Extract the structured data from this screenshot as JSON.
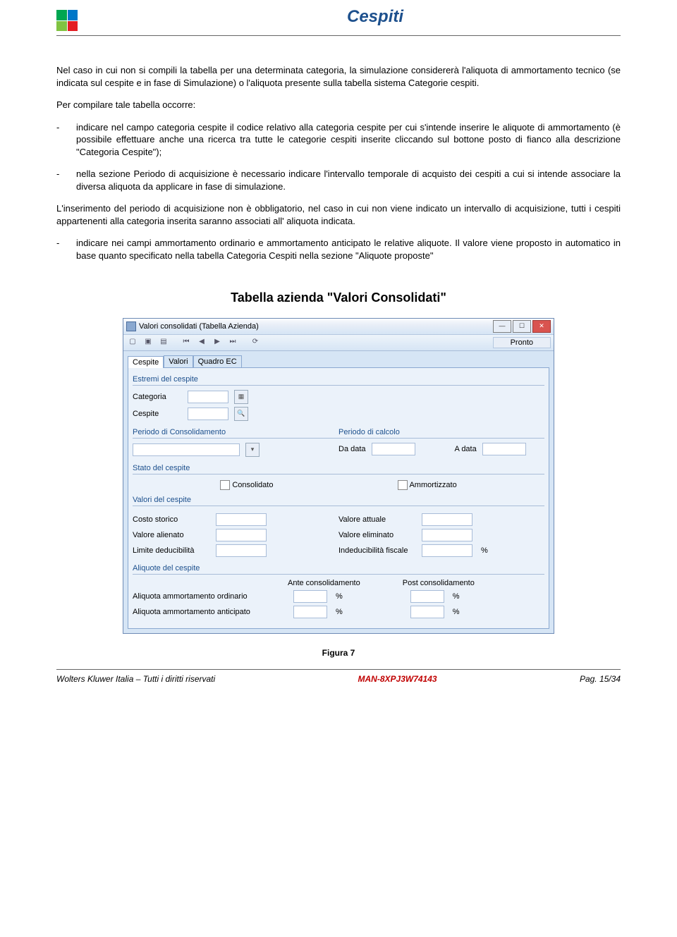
{
  "header": {
    "title": "Cespiti"
  },
  "text": {
    "p1": "Nel caso in cui non si compili la tabella per una determinata categoria, la simulazione considererà l'aliquota di ammortamento tecnico (se indicata sul cespite e in fase di Simulazione) o l'aliquota presente sulla tabella sistema Categorie cespiti.",
    "p2": "Per compilare tale tabella occorre:",
    "b1": "indicare nel campo categoria cespite il codice relativo alla categoria cespite per cui s'intende inserire le aliquote di ammortamento (è possibile effettuare anche una ricerca tra tutte le categorie cespiti inserite cliccando sul bottone posto di fianco alla descrizione \"Categoria Cespite\");",
    "b2": "nella sezione Periodo di acquisizione è necessario indicare l'intervallo temporale di acquisto dei cespiti a cui si intende associare la diversa aliquota da applicare in fase di simulazione.",
    "p3": "L'inserimento del periodo di acquisizione non è obbligatorio, nel caso in cui non viene indicato un intervallo di acquisizione, tutti i cespiti appartenenti alla categoria inserita saranno associati all' aliquota indicata.",
    "b3": "indicare nei campi ammortamento ordinario e ammortamento anticipato le relative aliquote. Il valore viene proposto in automatico in base quanto specificato nella tabella Categoria Cespiti nella sezione \"Aliquote proposte\""
  },
  "heading": "Tabella azienda \"Valori Consolidati\"",
  "win": {
    "title": "Valori consolidati (Tabella Azienda)",
    "status": "Pronto",
    "tabs": [
      "Cespite",
      "Valori",
      "Quadro EC"
    ],
    "groups": {
      "estremi": "Estremi del cespite",
      "periodoCons": "Periodo di Consolidamento",
      "periodoCalc": "Periodo di calcolo",
      "stato": "Stato del cespite",
      "valori": "Valori del cespite",
      "aliquote": "Aliquote del cespite"
    },
    "labels": {
      "categoria": "Categoria",
      "cespite": "Cespite",
      "daData": "Da data",
      "aData": "A data",
      "consolidato": "Consolidato",
      "ammortizzato": "Ammortizzato",
      "costoStorico": "Costo storico",
      "valoreAttuale": "Valore attuale",
      "valoreAlienato": "Valore alienato",
      "valoreEliminato": "Valore eliminato",
      "limiteDed": "Limite deducibilità",
      "indedFisc": "Indeducibilità fiscale",
      "anteCons": "Ante consolidamento",
      "postCons": "Post consolidamento",
      "aliqOrd": "Aliquota ammortamento ordinario",
      "aliqAnt": "Aliquota ammortamento anticipato"
    }
  },
  "figure": "Figura 7",
  "footer": {
    "left": "Wolters Kluwer Italia – Tutti i diritti riservati",
    "mid": "MAN-8XPJ3W74143",
    "right": "Pag.  15/34"
  }
}
